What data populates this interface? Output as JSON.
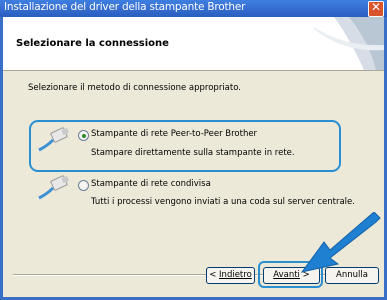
{
  "window": {
    "title": "Installazione del driver della stampante Brother",
    "close_symbol": "✕"
  },
  "header": {
    "title": "Selezionare la connessione"
  },
  "intro_text": "Selezionare il metodo di connessione appropriato.",
  "options": [
    {
      "label": "Stampante di rete Peer-to-Peer Brother",
      "description": "Stampare direttamente sulla stampante in rete.",
      "selected": true,
      "icon": "network-cable-icon"
    },
    {
      "label": "Stampante di rete condivisa",
      "description": "Tutti i processi vengono inviati a una coda sul server centrale.",
      "selected": false,
      "icon": "network-cable-icon"
    }
  ],
  "buttons": {
    "back_prefix": "< ",
    "back_label": "Indietro",
    "next_label": "Avanti",
    "next_suffix": " >",
    "cancel_label": "Annulla"
  },
  "colors": {
    "title_bar": "#2a5dc0",
    "highlight": "#2a8fd1",
    "dialog_bg": "#ece9d8"
  }
}
